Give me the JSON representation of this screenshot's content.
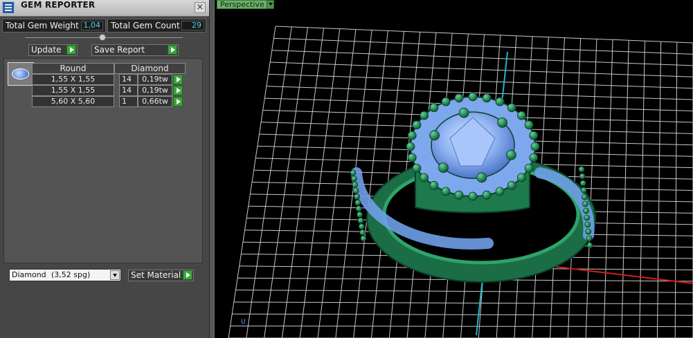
{
  "panel": {
    "title": "GEM REPORTER",
    "close_icon": "close-icon",
    "total_weight_label": "Total Gem Weight",
    "total_weight_value": "1,04",
    "total_count_label": "Total Gem Count",
    "total_count_value": "29",
    "update_label": "Update",
    "save_report_label": "Save Report",
    "gem_table": {
      "shape": "Round",
      "material": "Diamond",
      "rows": [
        {
          "size": "1,55 X 1,55",
          "count": "14",
          "weight": "0,19tw"
        },
        {
          "size": "1,55 X 1,55",
          "count": "14",
          "weight": "0,19tw"
        },
        {
          "size": "5,60 X 5,60",
          "count": "1",
          "weight": "0,66tw"
        }
      ]
    },
    "material_select": {
      "name": "Diamond",
      "density": "(3,52 spg)"
    },
    "set_material_label": "Set Material"
  },
  "viewport": {
    "view_mode": "Perspective",
    "axis_label": "U"
  },
  "colors": {
    "panel_bg": "#464646",
    "value_cyan": "#4fd4e8",
    "play_green": "#3aa53a",
    "ring_green": "#1f7d4f",
    "gem_blue": "#8fb3f2",
    "grid": "#c8c8c8"
  }
}
